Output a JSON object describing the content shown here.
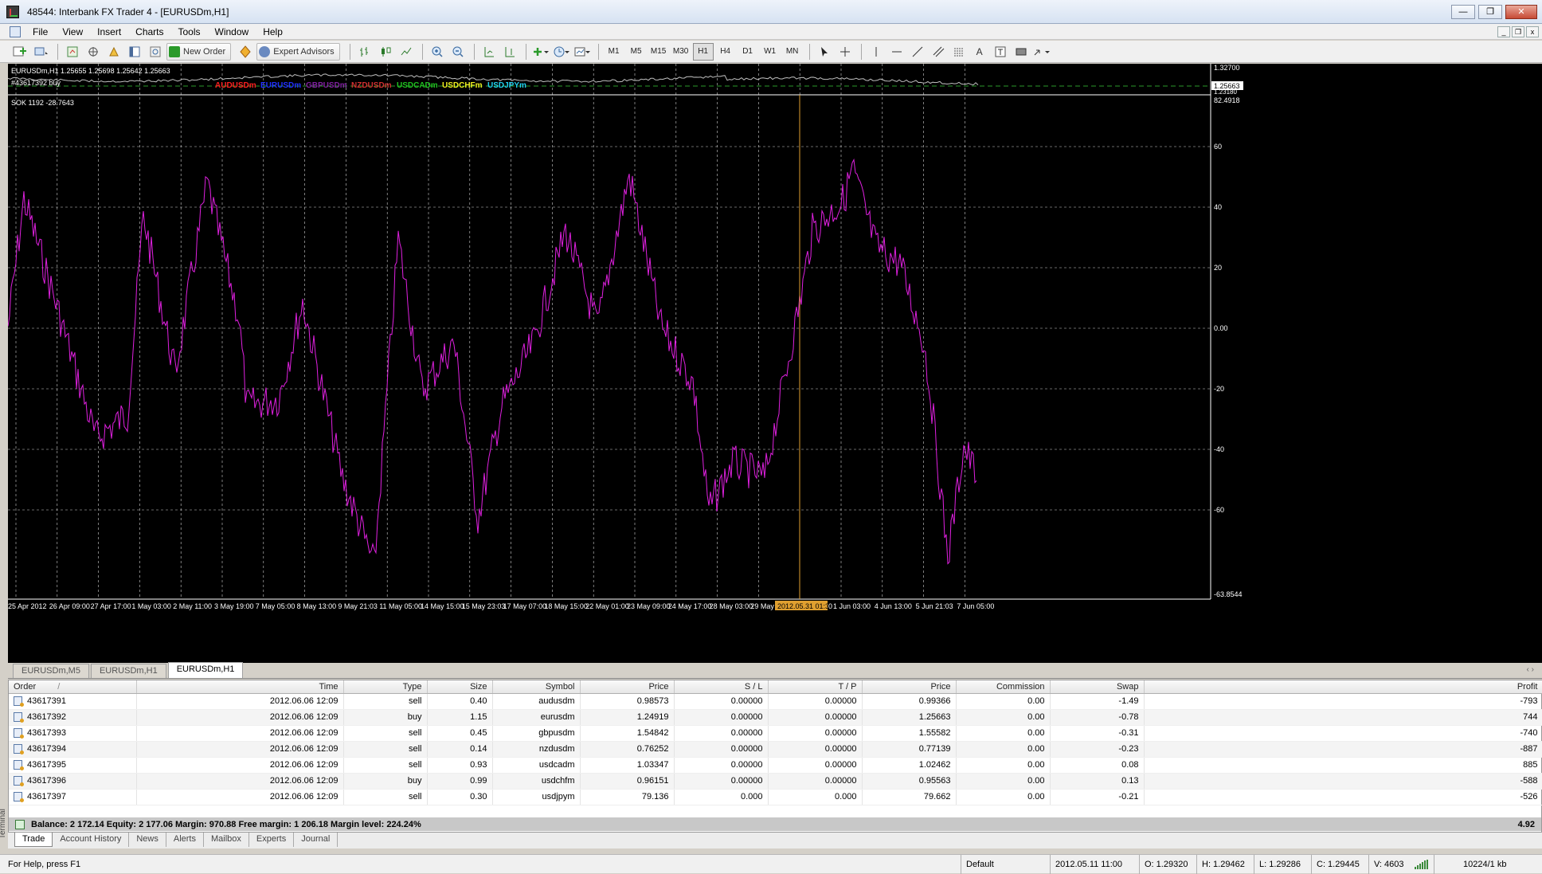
{
  "app": {
    "title": "48544: Interbank FX Trader 4 - [EURUSDm,H1]",
    "win_min": "—",
    "win_max": "❐",
    "win_close": "✕"
  },
  "menu": [
    "File",
    "View",
    "Insert",
    "Charts",
    "Tools",
    "Window",
    "Help"
  ],
  "mdi": {
    "min": "_",
    "restore": "❐",
    "close": "x"
  },
  "toolbar": {
    "new_order": "New Order",
    "expert_advisors": "Expert Advisors",
    "timeframes": [
      "M1",
      "M5",
      "M15",
      "M30",
      "H1",
      "H4",
      "D1",
      "W1",
      "MN"
    ],
    "active_timeframe": "H1"
  },
  "chart": {
    "main_header": "EURUSDm,H1  1.25655 1.25698 1.25642 1.25663",
    "order_label": "#43617392 buy",
    "indicator_header": "SOK 1192 -28.7643",
    "main_price_top": "1.32700",
    "main_price_current": "1.25663",
    "main_price_bottom": "1.23180",
    "legend": [
      {
        "name": "AUDUSDm",
        "color": "#ff2020"
      },
      {
        "name": "EURUSDm",
        "color": "#2030ff"
      },
      {
        "name": "GBPUSDm",
        "color": "#8020a0"
      },
      {
        "name": "NZDUSDm",
        "color": "#d03030"
      },
      {
        "name": "USDCADm",
        "color": "#20c020"
      },
      {
        "name": "USDCHFm",
        "color": "#f0f020"
      },
      {
        "name": "USDJPYm",
        "color": "#20d0f0"
      }
    ],
    "line_color": "#e020e0",
    "cursor_color": "#e0a030",
    "ind_scale": {
      "top_label": "82.4918",
      "bottom_label": "-63.8544"
    },
    "ind_levels": [
      "60",
      "40",
      "20",
      "0.00",
      "-20",
      "-40",
      "-60"
    ],
    "x_labels": [
      "25 Apr 2012",
      "26 Apr 09:00",
      "27 Apr 17:00",
      "1 May 03:00",
      "2 May 11:00",
      "3 May 19:00",
      "7 May 05:00",
      "8 May 13:00",
      "9 May 21:03",
      "11 May 05:00",
      "14 May 15:00",
      "15 May 23:03",
      "17 May 07:00",
      "18 May 15:00",
      "22 May 01:00",
      "23 May 09:00",
      "24 May 17:00",
      "28 May 03:00",
      "29 May",
      "",
      "1 Jun 03:00",
      "4 Jun 13:00",
      "5 Jun 21:03",
      "7 Jun 05:00"
    ],
    "cursor_label": "2012.05.31 01:30",
    "cursor_after": "0"
  },
  "chart_tabs": [
    "EURUSDm,M5",
    "EURUSDm,H1",
    "EURUSDm,H1"
  ],
  "chart_tab_nav": "‹  ›",
  "orders": {
    "columns": [
      "Order",
      "Time",
      "Type",
      "Size",
      "Symbol",
      "Price",
      "S / L",
      "T / P",
      "Price",
      "Commission",
      "Swap",
      "Profit"
    ],
    "sort_marker": "/",
    "rows": [
      [
        "43617391",
        "2012.06.06 12:09",
        "sell",
        "0.40",
        "audusdm",
        "0.98573",
        "0.00000",
        "0.00000",
        "0.99366",
        "0.00",
        "-1.49",
        "-793"
      ],
      [
        "43617392",
        "2012.06.06 12:09",
        "buy",
        "1.15",
        "eurusdm",
        "1.24919",
        "0.00000",
        "0.00000",
        "1.25663",
        "0.00",
        "-0.78",
        "744"
      ],
      [
        "43617393",
        "2012.06.06 12:09",
        "sell",
        "0.45",
        "gbpusdm",
        "1.54842",
        "0.00000",
        "0.00000",
        "1.55582",
        "0.00",
        "-0.31",
        "-740"
      ],
      [
        "43617394",
        "2012.06.06 12:09",
        "sell",
        "0.14",
        "nzdusdm",
        "0.76252",
        "0.00000",
        "0.00000",
        "0.77139",
        "0.00",
        "-0.23",
        "-887"
      ],
      [
        "43617395",
        "2012.06.06 12:09",
        "sell",
        "0.93",
        "usdcadm",
        "1.03347",
        "0.00000",
        "0.00000",
        "1.02462",
        "0.00",
        "0.08",
        "885"
      ],
      [
        "43617396",
        "2012.06.06 12:09",
        "buy",
        "0.99",
        "usdchfm",
        "0.96151",
        "0.00000",
        "0.00000",
        "0.95563",
        "0.00",
        "0.13",
        "-588"
      ],
      [
        "43617397",
        "2012.06.06 12:09",
        "sell",
        "0.30",
        "usdjpym",
        "79.136",
        "0.000",
        "0.000",
        "79.662",
        "0.00",
        "-0.21",
        "-526"
      ]
    ],
    "balance_line": "Balance: 2 172.14  Equity: 2 177.06  Margin: 970.88  Free margin: 1 206.18  Margin level: 224.24%",
    "total_profit": "4.92"
  },
  "terminal_label": "Terminal",
  "terminal_tabs": [
    "Trade",
    "Account History",
    "News",
    "Alerts",
    "Mailbox",
    "Experts",
    "Journal"
  ],
  "status": {
    "help": "For Help, press F1",
    "profile": "Default",
    "datetime": "2012.05.11 11:00",
    "open": "O: 1.29320",
    "high": "H: 1.29462",
    "low": "L: 1.29286",
    "close": "C: 1.29445",
    "volume": "V: 4603",
    "traffic": "10224/1 kb"
  }
}
